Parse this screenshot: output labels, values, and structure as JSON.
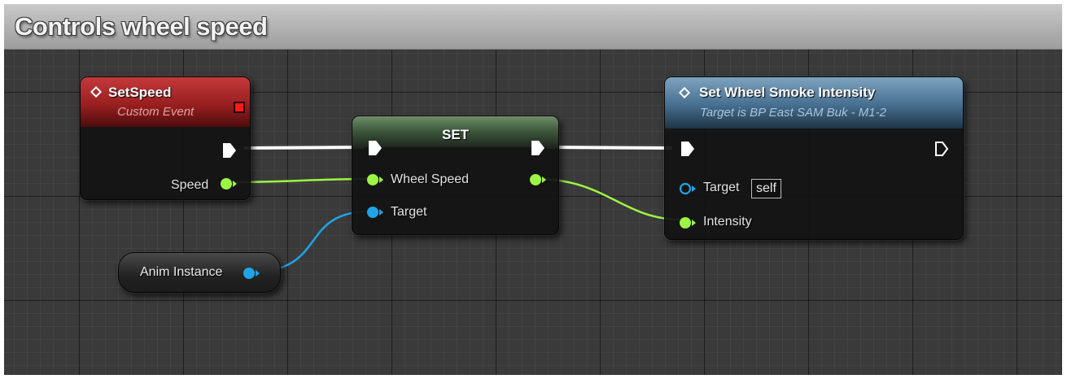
{
  "comment": {
    "title": "Controls wheel speed"
  },
  "colors": {
    "exec": "#ffffff",
    "float_pin": "#9cf545",
    "object_pin": "#1fa4e8",
    "event_header": "#a92628",
    "set_header": "#4c6b49",
    "function_header": "#5a82a3"
  },
  "nodes": {
    "set_speed": {
      "title": "SetSpeed",
      "subtitle": "Custom Event",
      "icon": "event-diamond-icon",
      "outputs": {
        "speed": "Speed"
      }
    },
    "set": {
      "title": "SET",
      "inputs": {
        "wheel_speed": "Wheel Speed",
        "target": "Target"
      }
    },
    "set_wheel_smoke": {
      "title": "Set Wheel Smoke Intensity",
      "subtitle": "Target is BP East SAM Buk - M1-2",
      "icon": "function-diamond-icon",
      "inputs": {
        "target": "Target",
        "target_default": "self",
        "intensity": "Intensity"
      }
    },
    "anim_instance": {
      "title": "Anim Instance"
    }
  }
}
